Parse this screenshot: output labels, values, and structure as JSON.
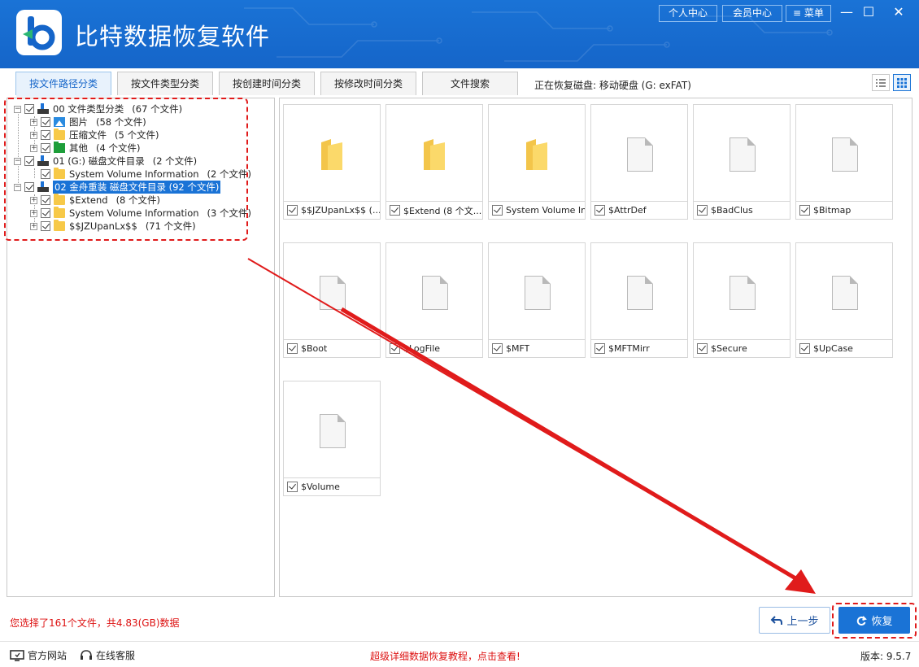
{
  "app": {
    "title": "比特数据恢复软件",
    "personal_center": "个人中心",
    "member_center": "会员中心",
    "menu": "菜单",
    "brand_color": "#1a73d6"
  },
  "tabs": [
    {
      "label": "按文件路径分类",
      "active": true
    },
    {
      "label": "按文件类型分类",
      "active": false
    },
    {
      "label": "按创建时间分类",
      "active": false
    },
    {
      "label": "按修改时间分类",
      "active": false
    },
    {
      "label": "文件搜索",
      "active": false
    }
  ],
  "recovering_label": "正在恢复磁盘: 移动硬盘 (G: exFAT)",
  "tree": [
    {
      "label": "00 文件类型分类",
      "count": "(67 个文件)",
      "icon": "drive-icon",
      "level": 0
    },
    {
      "label": "图片",
      "count": "(58 个文件)",
      "icon": "image-icon",
      "level": 1
    },
    {
      "label": "压缩文件",
      "count": "(5 个文件)",
      "icon": "folder-icon",
      "level": 1
    },
    {
      "label": "其他",
      "count": "(4 个文件)",
      "icon": "green-folder-icon",
      "level": 1
    },
    {
      "label": "01 (G:) 磁盘文件目录",
      "count": "(2 个文件)",
      "icon": "drive-icon",
      "level": 0
    },
    {
      "label": "System Volume Information",
      "count": "(2 个文件)",
      "icon": "folder-icon",
      "level": 1
    },
    {
      "label": "02 金舟重装 磁盘文件目录",
      "count": "(92 个文件)",
      "icon": "drive-icon",
      "level": 0,
      "selected": true
    },
    {
      "label": "$Extend",
      "count": "(8 个文件)",
      "icon": "folder-icon",
      "level": 1
    },
    {
      "label": "System Volume Information",
      "count": "(3 个文件)",
      "icon": "folder-icon",
      "level": 1
    },
    {
      "label": "$$JZUpanLx$$",
      "count": "(71 个文件)",
      "icon": "folder-icon",
      "level": 1
    }
  ],
  "files": [
    {
      "name": "$$JZUpanLx$$ (...",
      "type": "folder"
    },
    {
      "name": "$Extend  (8 个文...",
      "type": "folder"
    },
    {
      "name": "System Volume In...",
      "type": "folder"
    },
    {
      "name": "$AttrDef",
      "type": "file"
    },
    {
      "name": "$BadClus",
      "type": "file"
    },
    {
      "name": "$Bitmap",
      "type": "file"
    },
    {
      "name": "$Boot",
      "type": "file"
    },
    {
      "name": "$LogFile",
      "type": "file"
    },
    {
      "name": "$MFT",
      "type": "file"
    },
    {
      "name": "$MFTMirr",
      "type": "file"
    },
    {
      "name": "$Secure",
      "type": "file"
    },
    {
      "name": "$UpCase",
      "type": "file"
    },
    {
      "name": "$Volume",
      "type": "file"
    }
  ],
  "footer": {
    "selection_status": "您选择了161个文件，共4.83(GB)数据",
    "prev_label": "上一步",
    "recover_label": "恢复",
    "website": "官方网站",
    "support": "在线客服",
    "tutorial": "超级详细数据恢复教程，点击查看!",
    "version": "版本: 9.5.7"
  }
}
